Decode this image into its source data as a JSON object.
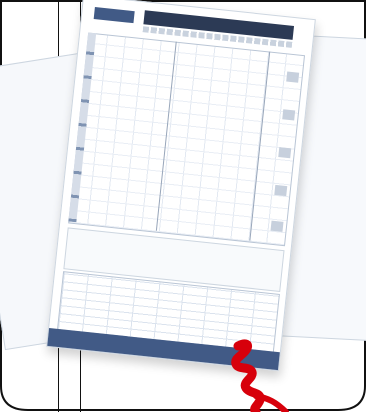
{
  "scene": {
    "description_subjects": [
      "document-stack",
      "handwritten-red-mark"
    ],
    "colors": {
      "frame": "#111111",
      "card_header": "#2c3a55",
      "card_accent": "#415a86",
      "mark": "#d7000b"
    }
  },
  "document": {
    "logo_text": "",
    "title_text": "",
    "subtitle_text": ""
  }
}
